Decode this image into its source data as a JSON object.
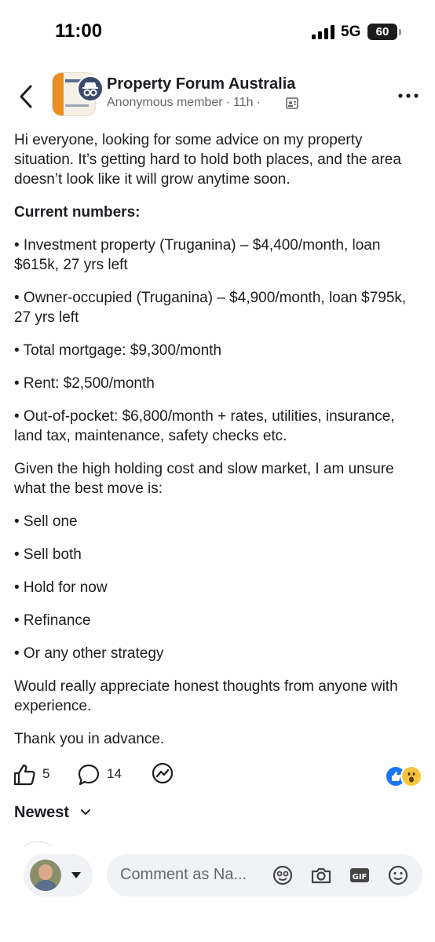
{
  "status_bar": {
    "time": "11:00",
    "network": "5G",
    "battery": "60"
  },
  "header": {
    "group_name": "Property Forum Australia",
    "author": "Anonymous member",
    "time_ago": "11h",
    "separator": "·"
  },
  "post": {
    "intro": "Hi everyone, looking for some advice on my property situation. It’s getting hard to hold both places, and the area doesn’t look like it will grow anytime soon.",
    "numbers_heading": "Current numbers:",
    "numbers": [
      "• Investment property (Truganina) – $4,400/month, loan $615k, 27 yrs left",
      "• Owner-occupied (Truganina) – $4,900/month, loan $795k, 27 yrs left",
      "• Total mortgage: $9,300/month",
      "• Rent: $2,500/month",
      "• Out-of-pocket: $6,800/month + rates, utilities, insurance, land tax, maintenance, safety checks etc."
    ],
    "question": "Given the high holding cost and slow market, I am unsure what the best move is:",
    "options": [
      "• Sell one",
      "• Sell both",
      "• Hold for now",
      "• Refinance",
      "• Or any other strategy"
    ],
    "closing": "Would really appreciate honest thoughts from anyone with experience.",
    "thanks": "Thank you in advance."
  },
  "actions": {
    "like_count": "5",
    "comment_count": "14"
  },
  "sort": {
    "label": "Newest"
  },
  "composer": {
    "placeholder": "Comment as Na..."
  },
  "colors": {
    "accent": "#1877f2",
    "text": "#1c1e21",
    "secondary": "#65676b",
    "input_bg": "#f0f2f5"
  },
  "icons": [
    "back-arrow-icon",
    "anonymous-icon",
    "privacy-icon",
    "more-icon",
    "like-icon",
    "comment-icon",
    "share-icon",
    "chevron-down-icon",
    "sticker-icon",
    "camera-icon",
    "gif-icon",
    "emoji-icon"
  ]
}
